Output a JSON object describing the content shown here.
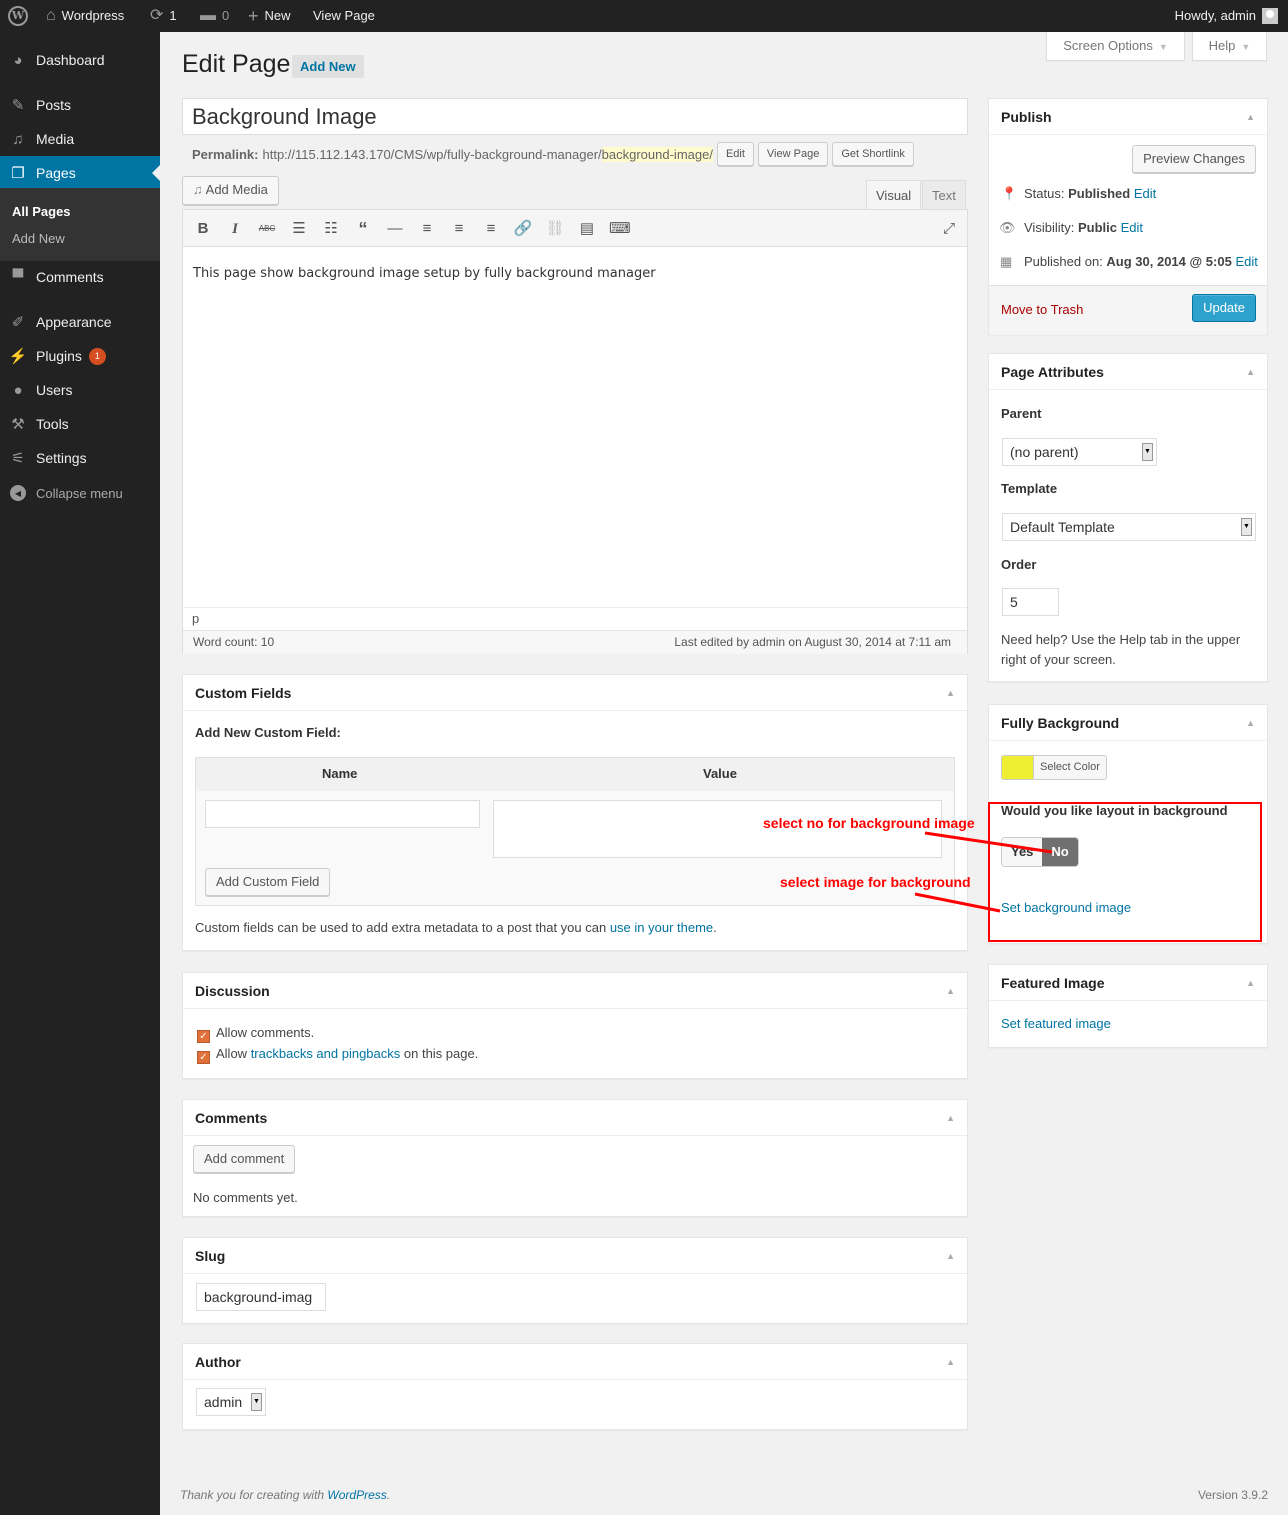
{
  "adminbar": {
    "site_name": "Wordpress",
    "updates_count": "1",
    "comments_count": "0",
    "new_label": "New",
    "view_page_label": "View Page",
    "howdy": "Howdy, admin"
  },
  "sidebar": {
    "items": [
      {
        "label": "Dashboard",
        "icon": "dashboard-icon"
      },
      {
        "label": "Posts",
        "icon": "pin-icon"
      },
      {
        "label": "Media",
        "icon": "media-icon"
      },
      {
        "label": "Pages",
        "icon": "pages-icon"
      },
      {
        "label": "Comments",
        "icon": "comment-icon"
      },
      {
        "label": "Appearance",
        "icon": "brush-icon"
      },
      {
        "label": "Plugins",
        "icon": "plug-icon",
        "badge": "1"
      },
      {
        "label": "Users",
        "icon": "user-icon"
      },
      {
        "label": "Tools",
        "icon": "wrench-icon"
      },
      {
        "label": "Settings",
        "icon": "settings-icon"
      }
    ],
    "submenu": [
      "All Pages",
      "Add New"
    ],
    "collapse_label": "Collapse menu"
  },
  "screen_meta": {
    "screen_options": "Screen Options",
    "help": "Help"
  },
  "page": {
    "title": "Edit Page",
    "add_new": "Add New"
  },
  "post": {
    "title_value": "Background Image",
    "permalink_label": "Permalink:",
    "permalink_base": "http://115.112.143.170/CMS/wp/fully-background-manager/",
    "permalink_slug": "background-image/",
    "edit_btn": "Edit",
    "view_page_btn": "View Page",
    "shortlink_btn": "Get Shortlink"
  },
  "editor": {
    "add_media": "Add Media",
    "tab_visual": "Visual",
    "tab_text": "Text",
    "content": "This page show background image setup by fully background manager",
    "path": "p",
    "word_count": "Word count: 10",
    "last_edited": "Last edited by admin on August 30, 2014 at 7:11 am",
    "toolbar": [
      "bold",
      "italic",
      "strikethrough",
      "bullet-list",
      "numbered-list",
      "blockquote",
      "horizontal-rule",
      "align-left",
      "align-center",
      "align-right",
      "link",
      "unlink",
      "read-more",
      "toolbar-toggle",
      "fullscreen"
    ]
  },
  "custom_fields": {
    "title": "Custom Fields",
    "add_new_label": "Add New Custom Field:",
    "col_name": "Name",
    "col_value": "Value",
    "name_value": "",
    "value_value": "",
    "add_btn": "Add Custom Field",
    "help_prefix": "Custom fields can be used to add extra metadata to a post that you can ",
    "help_link": "use in your theme",
    "help_suffix": "."
  },
  "discussion": {
    "title": "Discussion",
    "allow_comments": "Allow comments.",
    "allow_prefix": "Allow ",
    "allow_link": "trackbacks and pingbacks",
    "allow_suffix": " on this page.",
    "comments_checked": true,
    "pings_checked": true
  },
  "comments": {
    "title": "Comments",
    "add_btn": "Add comment",
    "empty": "No comments yet."
  },
  "slug": {
    "title": "Slug",
    "value": "background-imag"
  },
  "author": {
    "title": "Author",
    "value": "admin"
  },
  "publish": {
    "title": "Publish",
    "preview_btn": "Preview Changes",
    "status_label": "Status:",
    "status_value": "Published",
    "visibility_label": "Visibility:",
    "visibility_value": "Public",
    "published_label": "Published on:",
    "published_value": "Aug 30, 2014 @ 5:05",
    "edit_link": "Edit",
    "trash": "Move to Trash",
    "update_btn": "Update"
  },
  "page_attributes": {
    "title": "Page Attributes",
    "parent_label": "Parent",
    "parent_value": "(no parent)",
    "template_label": "Template",
    "template_value": "Default Template",
    "order_label": "Order",
    "order_value": "5",
    "help_text": "Need help? Use the Help tab in the upper right of your screen."
  },
  "fully_background": {
    "title": "Fully Background",
    "color_swatch": "#eeee33",
    "select_color": "Select Color",
    "layout_question": "Would you like layout in background",
    "yes": "Yes",
    "no": "No",
    "selected": "No",
    "set_bg_link": "Set background image"
  },
  "featured_image": {
    "title": "Featured Image",
    "link": "Set featured image"
  },
  "annotations": {
    "note_no": "select no for background image",
    "note_image": "select image for background",
    "color": "#ff0000"
  },
  "footer": {
    "thanks_prefix": "Thank you for creating with ",
    "thanks_link": "WordPress",
    "thanks_suffix": ".",
    "version": "Version 3.9.2"
  }
}
